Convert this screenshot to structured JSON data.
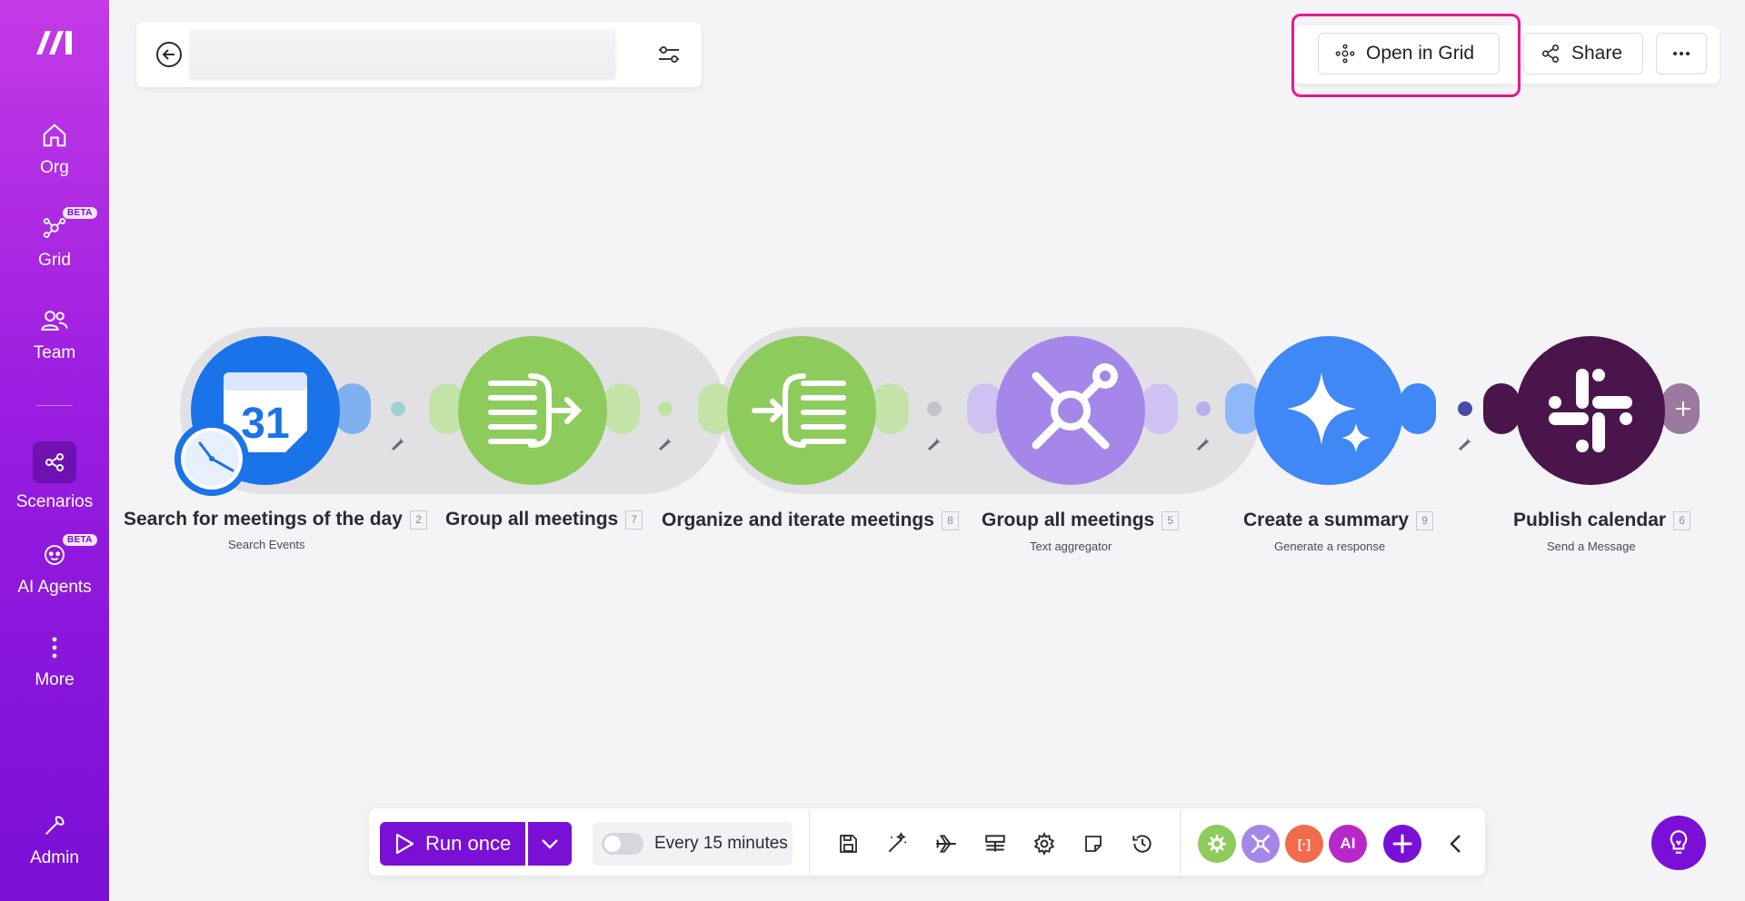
{
  "sidebar": {
    "items": [
      {
        "label": "Org",
        "icon": "home-icon"
      },
      {
        "label": "Grid",
        "icon": "grid-icon",
        "badge": "BETA"
      },
      {
        "label": "Team",
        "icon": "team-icon"
      },
      {
        "label": "Scenarios",
        "icon": "scenarios-icon",
        "active": true
      },
      {
        "label": "AI Agents",
        "icon": "ai-agents-icon",
        "badge": "BETA"
      },
      {
        "label": "More",
        "icon": "more-vertical-icon"
      },
      {
        "label": "Admin",
        "icon": "wrench-icon"
      }
    ]
  },
  "header": {
    "open_in_grid_label": "Open in Grid",
    "share_label": "Share"
  },
  "scenario": {
    "modules": [
      {
        "title": "Search for meetings of the day",
        "id": "2",
        "subtitle": "Search Events",
        "app": "Google Calendar",
        "color": "#1a73e8"
      },
      {
        "title": "Group all meetings",
        "id": "7",
        "subtitle": "",
        "app": "Flow Control",
        "color": "#8ecb5d"
      },
      {
        "title": "Organize and iterate meetings",
        "id": "8",
        "subtitle": "",
        "app": "Flow Control",
        "color": "#8ecb5d"
      },
      {
        "title": "Group all meetings",
        "id": "5",
        "subtitle": "Text aggregator",
        "app": "Tools",
        "color": "#a487e8"
      },
      {
        "title": "Create a summary",
        "id": "9",
        "subtitle": "Generate a response",
        "app": "Gemini",
        "color": "#3f88f5"
      },
      {
        "title": "Publish calendar",
        "id": "6",
        "subtitle": "Send a Message",
        "app": "Slack",
        "color": "#4a154b"
      }
    ]
  },
  "toolbar": {
    "run_once_label": "Run once",
    "schedule_label": "Every 15 minutes",
    "schedule_enabled": false,
    "tools": [
      "save-icon",
      "auto-align-icon",
      "flight-icon",
      "data-structure-icon",
      "settings-icon",
      "notes-icon",
      "history-icon"
    ],
    "apps": [
      {
        "label": "",
        "icon": "flow-control-icon",
        "color": "#8ecb5d"
      },
      {
        "label": "",
        "icon": "tools-icon",
        "color": "#a487e8"
      },
      {
        "label": "[·]",
        "icon": "json-icon",
        "color": "#f26b4b"
      },
      {
        "label": "AI",
        "icon": "ai-icon",
        "color": "#b628c8"
      }
    ]
  }
}
